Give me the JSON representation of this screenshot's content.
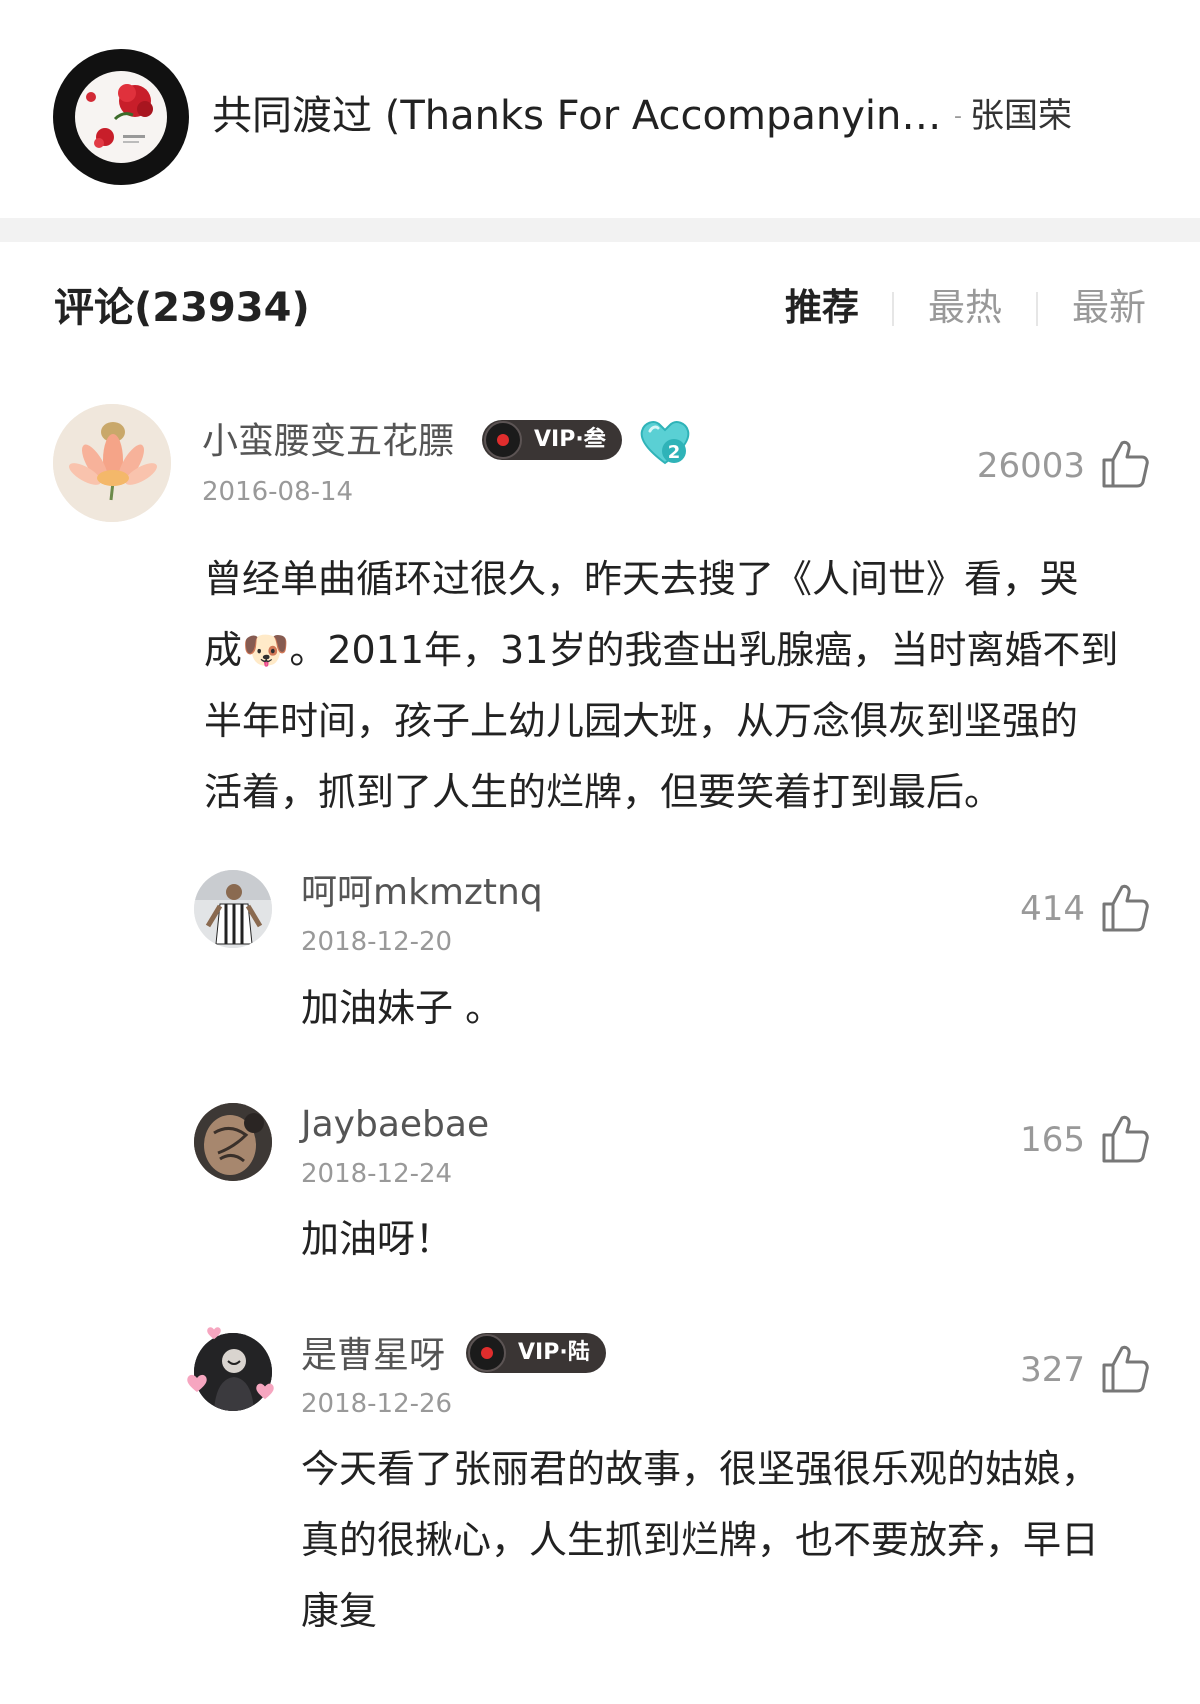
{
  "song": {
    "title": "共同渡过 (Thanks For Accompanying …",
    "separator": "-",
    "artist": "张国荣"
  },
  "comments_header": {
    "title": "评论(23934)",
    "tabs": [
      "推荐",
      "最热",
      "最新"
    ],
    "active_tab": "推荐"
  },
  "colors": {
    "accent_text": "#222222",
    "muted_text": "#999999",
    "vip_badge_bg": "#3a3534",
    "heart_badge": "#5ad0d4"
  },
  "main_comment": {
    "user": "小蛮腰变五花膘",
    "vip_label": "VIP·叁",
    "heart_level": "2",
    "date": "2016-08-14",
    "likes": "26003",
    "text_lines": [
      "曾经单曲循环过很久，昨天去搜了《人间世》看，哭",
      "成🐶。2011年，31岁的我查出乳腺癌，当时离婚不到",
      "半年时间，孩子上幼儿园大班，从万念俱灰到坚强的",
      "活着，抓到了人生的烂牌，但要笑着打到最后。"
    ]
  },
  "replies": [
    {
      "user": "呵呵mkmztnq",
      "date": "2018-12-20",
      "likes": "414",
      "text_lines": [
        "加油妹子 。"
      ]
    },
    {
      "user": "Jaybaebae",
      "date": "2018-12-24",
      "likes": "165",
      "text_lines": [
        "加油呀！"
      ]
    },
    {
      "user": "是曹星呀",
      "vip_label": "VIP·陆",
      "date": "2018-12-26",
      "likes": "327",
      "text_lines": [
        "今天看了张丽君的故事，很坚强很乐观的姑娘，",
        "真的很揪心，人生抓到烂牌，也不要放弃，早日",
        "康复"
      ]
    }
  ]
}
